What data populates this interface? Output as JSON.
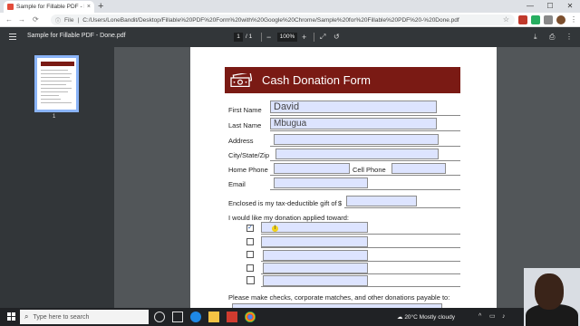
{
  "browser": {
    "tab_title": "Sample for Fillable PDF - Done.p",
    "tab_close": "×",
    "new_tab": "+",
    "url_scheme": "File",
    "url": "C:/Users/LoneBandit/Desktop/Fillable%20PDF%20Form%20with%20Google%20Chrome/Sample%20for%20Fillable%20PDF%20-%20Done.pdf",
    "window_controls": [
      "—",
      "☐",
      "✕"
    ],
    "nav": {
      "back": "←",
      "forward": "→",
      "reload": "⟳"
    },
    "colors": {
      "tab_strip": "#dee1e6",
      "omnibox": "#f1f3f4"
    }
  },
  "pdf_toolbar": {
    "title": "Sample for Fillable PDF - Done.pdf",
    "page_current": "1",
    "page_total": "/  1",
    "zoom_out": "−",
    "zoom": "100%",
    "zoom_in": "+",
    "download_icon": "⤓",
    "print_icon": "⎙",
    "more_icon": "⋮"
  },
  "sidebar": {
    "thumbnail_label": "1"
  },
  "form": {
    "title": "Cash Donation Form",
    "banner_color": "#7a1a14",
    "fields": {
      "first_name_label": "First Name",
      "first_name_value": "David",
      "last_name_label": "Last Name",
      "last_name_value": "Mbugua",
      "address_label": "Address",
      "city_label": "City/State/Zip",
      "home_phone_label": "Home Phone",
      "cell_phone_label": "Cell Phone",
      "email_label": "Email"
    },
    "gift_label": "Enclosed is my tax-deductible gift of",
    "currency": "$",
    "applied_label": "I would like my donation applied toward:",
    "checkbox_checked_mark": "✓",
    "checkboxes_checked": [
      true,
      false,
      false,
      false,
      false
    ],
    "cursor_glyph": "I",
    "payable_label": "Please make checks, corporate matches, and other donations payable to:"
  },
  "taskbar": {
    "search_placeholder": "Type here to search",
    "weather_temp": "20°C",
    "weather_text": "Mostly cloudy"
  }
}
